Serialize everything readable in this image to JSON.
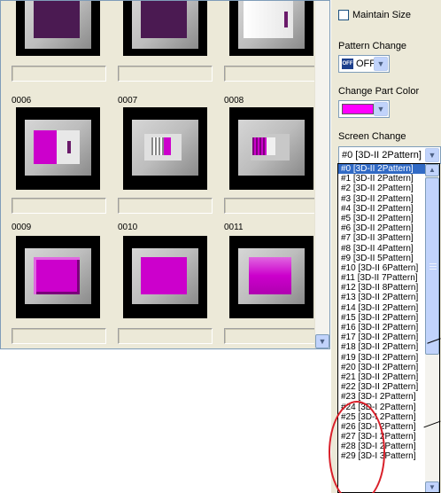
{
  "gallery": {
    "labels": [
      "0006",
      "0007",
      "0008",
      "0009",
      "0010",
      "0011"
    ]
  },
  "properties": {
    "maintain_size_label": "Maintain Size",
    "pattern_change_label": "Pattern Change",
    "pattern_change_value": "OFF",
    "pattern_icon_text": "OFF",
    "change_part_color_label": "Change Part Color",
    "part_color": "#ff00ff",
    "screen_change_label": "Screen Change",
    "screen_change_value": "#0 [3D-II 2Pattern]"
  },
  "screen_list": [
    "#0 [3D-II 2Pattern]",
    "#1 [3D-II 2Pattern]",
    "#2 [3D-II 2Pattern]",
    "#3 [3D-II 2Pattern]",
    "#4 [3D-II 2Pattern]",
    "#5 [3D-II 2Pattern]",
    "#6 [3D-II 2Pattern]",
    "#7 [3D-II 3Pattern]",
    "#8 [3D-II 4Pattern]",
    "#9 [3D-II 5Pattern]",
    "#10 [3D-II 6Pattern]",
    "#11 [3D-II 7Pattern]",
    "#12 [3D-II 8Pattern]",
    "#13 [3D-II 2Pattern]",
    "#14 [3D-II 2Pattern]",
    "#15 [3D-II 2Pattern]",
    "#16 [3D-II 2Pattern]",
    "#17 [3D-II 2Pattern]",
    "#18 [3D-II 2Pattern]",
    "#19 [3D-II 2Pattern]",
    "#20 [3D-II 2Pattern]",
    "#21 [3D-II 2Pattern]",
    "#22 [3D-II 2Pattern]",
    "#23 [3D-I 2Pattern]",
    "#24 [3D-I 2Pattern]",
    "#25 [3D-I 2Pattern]",
    "#26 [3D-I 2Pattern]",
    "#27 [3D-I 2Pattern]",
    "#28 [3D-I 2Pattern]",
    "#29 [3D-I 3Pattern]"
  ],
  "selected_index": 0,
  "colors": {
    "accent": "#316ac5",
    "magenta": "#ff00ff",
    "dark_purple": "#4b1a52",
    "highlight_circle": "#d9202a"
  }
}
